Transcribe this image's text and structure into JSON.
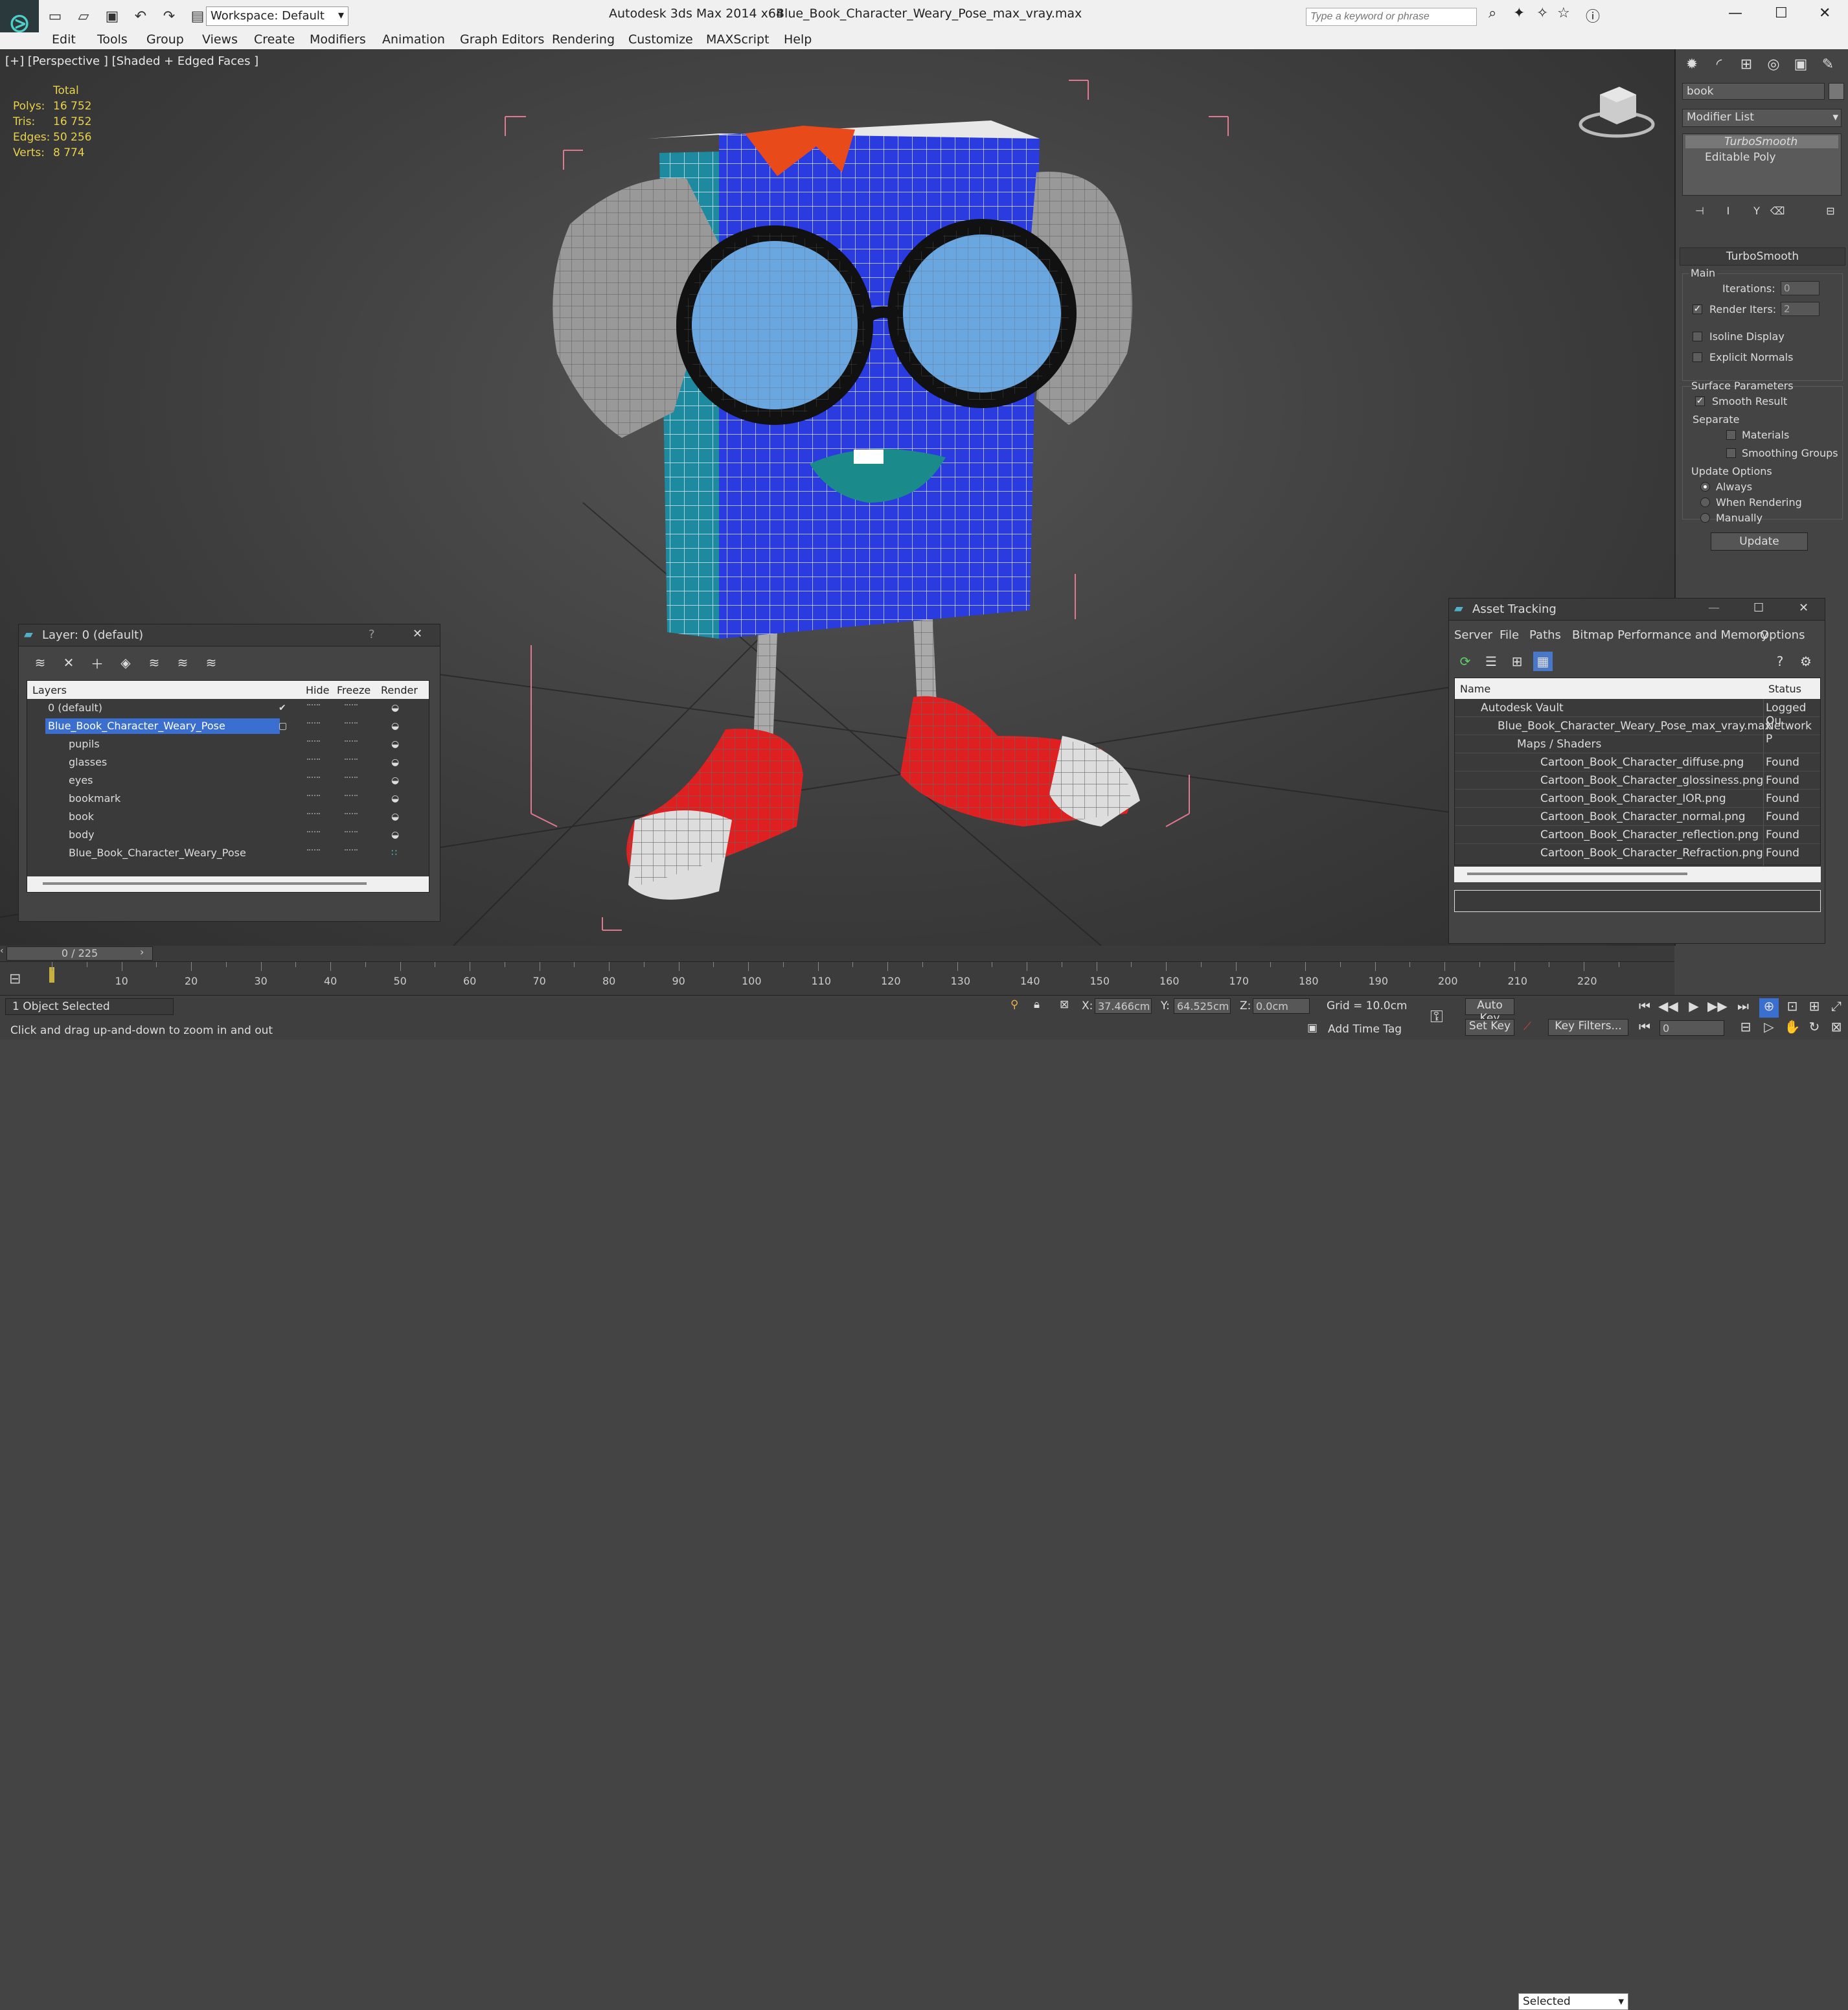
{
  "titlebar": {
    "workspace": "Workspace: Default",
    "app": "Autodesk 3ds Max  2014 x64",
    "file": "Blue_Book_Character_Weary_Pose_max_vray.max",
    "search_placeholder": "Type a keyword or phrase"
  },
  "menu": [
    "Edit",
    "Tools",
    "Group",
    "Views",
    "Create",
    "Modifiers",
    "Animation",
    "Graph Editors",
    "Rendering",
    "Customize",
    "MAXScript",
    "Help"
  ],
  "viewport": {
    "label": "[+] [Perspective ] [Shaded + Edged Faces ]",
    "stats": {
      "total": "Total",
      "rows": [
        {
          "k": "Polys:",
          "v": "16 752"
        },
        {
          "k": "Tris:",
          "v": "16 752"
        },
        {
          "k": "Edges:",
          "v": "50 256"
        },
        {
          "k": "Verts:",
          "v": "8 774"
        }
      ]
    }
  },
  "cmdpanel": {
    "object_name": "book",
    "modifier_list": "Modifier List",
    "stack": [
      "TurboSmooth",
      "Editable Poly"
    ],
    "rollout": "TurboSmooth",
    "main": "Main",
    "iterations_label": "Iterations:",
    "iterations": "0",
    "render_iters_label": "Render Iters:",
    "render_iters": "2",
    "isoline": "Isoline Display",
    "explicit_normals": "Explicit Normals",
    "surface_params": "Surface Parameters",
    "smooth_result": "Smooth Result",
    "separate": "Separate",
    "materials": "Materials",
    "smoothing_groups": "Smoothing Groups",
    "update_options": "Update Options",
    "always": "Always",
    "when_rendering": "When Rendering",
    "manually": "Manually",
    "update": "Update"
  },
  "layers": {
    "title": "Layer: 0 (default)",
    "help": "?",
    "cols": {
      "layers": "Layers",
      "hide": "Hide",
      "freeze": "Freeze",
      "render": "Render"
    },
    "rows": [
      {
        "name": "0 (default)"
      },
      {
        "name": "Blue_Book_Character_Weary_Pose"
      },
      {
        "name": "pupils"
      },
      {
        "name": "glasses"
      },
      {
        "name": "eyes"
      },
      {
        "name": "bookmark"
      },
      {
        "name": "book"
      },
      {
        "name": "body"
      },
      {
        "name": "Blue_Book_Character_Weary_Pose"
      }
    ]
  },
  "assets": {
    "title": "Asset Tracking",
    "menu": [
      "Server",
      "File",
      "Paths",
      "Bitmap Performance and Memory",
      "Options"
    ],
    "cols": {
      "name": "Name",
      "status": "Status"
    },
    "rows": [
      {
        "name": "Autodesk Vault",
        "status": "Logged Ou"
      },
      {
        "name": "Blue_Book_Character_Weary_Pose_max_vray.max",
        "status": "Network P"
      },
      {
        "name": "Maps / Shaders",
        "status": ""
      },
      {
        "name": "Cartoon_Book_Character_diffuse.png",
        "status": "Found"
      },
      {
        "name": "Cartoon_Book_Character_glossiness.png",
        "status": "Found"
      },
      {
        "name": "Cartoon_Book_Character_IOR.png",
        "status": "Found"
      },
      {
        "name": "Cartoon_Book_Character_normal.png",
        "status": "Found"
      },
      {
        "name": "Cartoon_Book_Character_reflection.png",
        "status": "Found"
      },
      {
        "name": "Cartoon_Book_Character_Refraction.png",
        "status": "Found"
      }
    ]
  },
  "timeline": {
    "slider": "0 / 225",
    "ticks": [
      "10",
      "20",
      "30",
      "40",
      "50",
      "60",
      "70",
      "80",
      "90",
      "100",
      "110",
      "120",
      "130",
      "140",
      "150",
      "160",
      "170",
      "180",
      "190",
      "200",
      "210",
      "220"
    ]
  },
  "status": {
    "selected": "1 Object Selected",
    "hint": "Click and drag up-and-down to zoom in and out",
    "x_label": "X:",
    "x": "37.466cm",
    "y_label": "Y:",
    "y": "64.525cm",
    "z_label": "Z:",
    "z": "0.0cm",
    "grid": "Grid = 10.0cm",
    "add_time_tag": "Add Time Tag",
    "auto_key": "Auto Key",
    "set_key": "Set Key",
    "selected_dd": "Selected",
    "key_filters": "Key Filters...",
    "frame": "0"
  }
}
